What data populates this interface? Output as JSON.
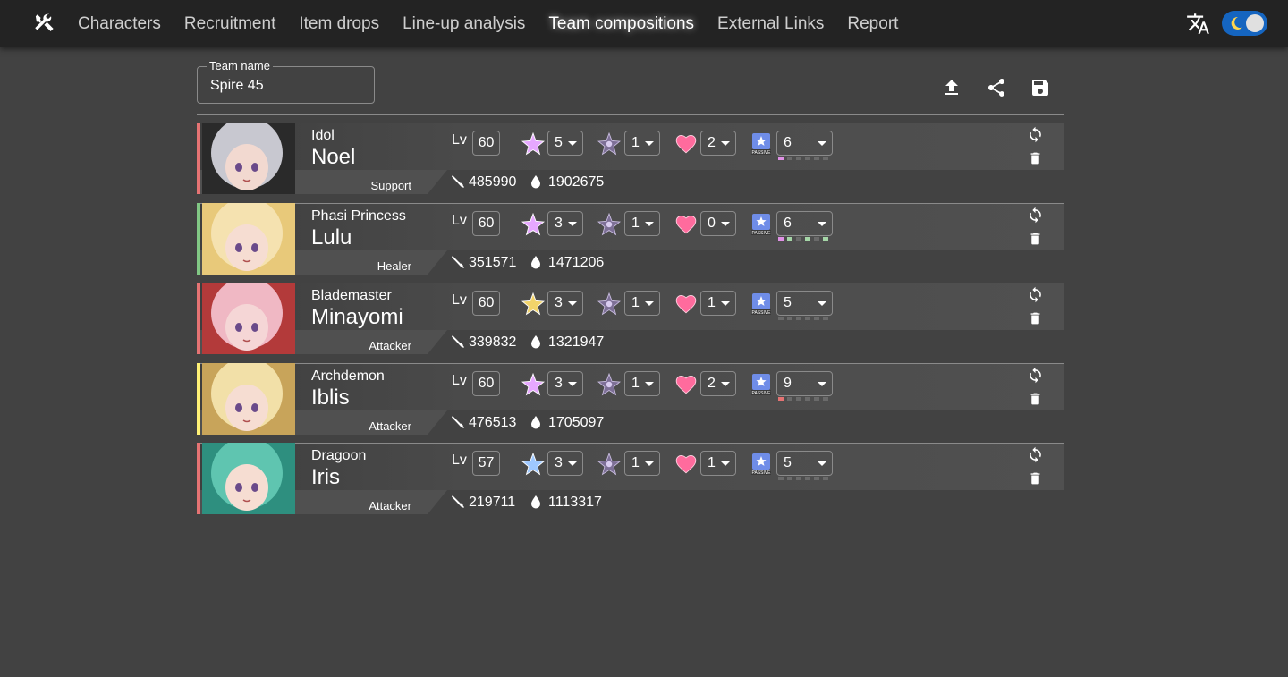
{
  "nav": {
    "logo_icon": "tools-icon",
    "links": [
      "Characters",
      "Recruitment",
      "Item drops",
      "Line-up analysis",
      "Team compositions",
      "External Links",
      "Report"
    ],
    "active_link": "Team compositions",
    "translate_icon": "translate-icon",
    "theme_toggle": {
      "mode": "dark",
      "accent": "#1565c0"
    }
  },
  "team": {
    "label": "Team name",
    "value": "Spire 45"
  },
  "toolbar": {
    "upload_icon": "upload-icon",
    "share_icon": "share-icon",
    "save_icon": "save-icon"
  },
  "characters": [
    {
      "title": "Idol",
      "name": "Noel",
      "role": "Support",
      "role_color": "#e57373",
      "lv": "60",
      "star": "5",
      "star_color": "#e6a7ff",
      "awake": "1",
      "love": "2",
      "passive": "6",
      "passive_dots": [
        1,
        0,
        0,
        0,
        0,
        0
      ],
      "dot_color": "#e091e6",
      "atk": "485990",
      "hp": "1902675",
      "portrait": [
        "#2a2a2a",
        "#c8c8d0",
        "#f2d9d0"
      ]
    },
    {
      "title": "Phasi Princess",
      "name": "Lulu",
      "role": "Healer",
      "role_color": "#81c784",
      "lv": "60",
      "star": "3",
      "star_color": "#e6a7ff",
      "awake": "1",
      "love": "0",
      "passive": "6",
      "passive_dots": [
        1,
        1,
        0,
        1,
        0,
        1
      ],
      "dot_color": "#a5d6a7",
      "dot_color2": "#e091e6",
      "atk": "351571",
      "hp": "1471206",
      "portrait": [
        "#e8c97a",
        "#f5e2b0",
        "#f6ddd2"
      ]
    },
    {
      "title": "Blademaster",
      "name": "Minayomi",
      "role": "Attacker",
      "role_color": "#e57373",
      "lv": "60",
      "star": "3",
      "star_color": "#f2d46a",
      "awake": "1",
      "love": "1",
      "passive": "5",
      "passive_dots": [
        0,
        0,
        0,
        0,
        0,
        0
      ],
      "dot_color": "#6a6a6a",
      "atk": "339832",
      "hp": "1321947",
      "portrait": [
        "#b33a3a",
        "#f0b8c4",
        "#f5d6d6"
      ]
    },
    {
      "title": "Archdemon",
      "name": "Iblis",
      "role": "Attacker",
      "role_color": "#fff176",
      "lv": "60",
      "star": "3",
      "star_color": "#e6a7ff",
      "awake": "1",
      "love": "2",
      "passive": "9",
      "passive_dots": [
        1,
        0,
        0,
        0,
        0,
        0
      ],
      "dot_color": "#e57373",
      "atk": "476513",
      "hp": "1705097",
      "portrait": [
        "#c8a45a",
        "#f2e0a8",
        "#f6ddd2"
      ]
    },
    {
      "title": "Dragoon",
      "name": "Iris",
      "role": "Attacker",
      "role_color": "#e57373",
      "lv": "57",
      "star": "3",
      "star_color": "#9ec8ff",
      "awake": "1",
      "love": "1",
      "passive": "5",
      "passive_dots": [
        0,
        0,
        0,
        0,
        0,
        0
      ],
      "dot_color": "#6a6a6a",
      "atk": "219711",
      "hp": "1113317",
      "portrait": [
        "#2e8f7f",
        "#5fc5b0",
        "#f6ddd2"
      ]
    }
  ],
  "labels": {
    "lv": "Lv"
  }
}
